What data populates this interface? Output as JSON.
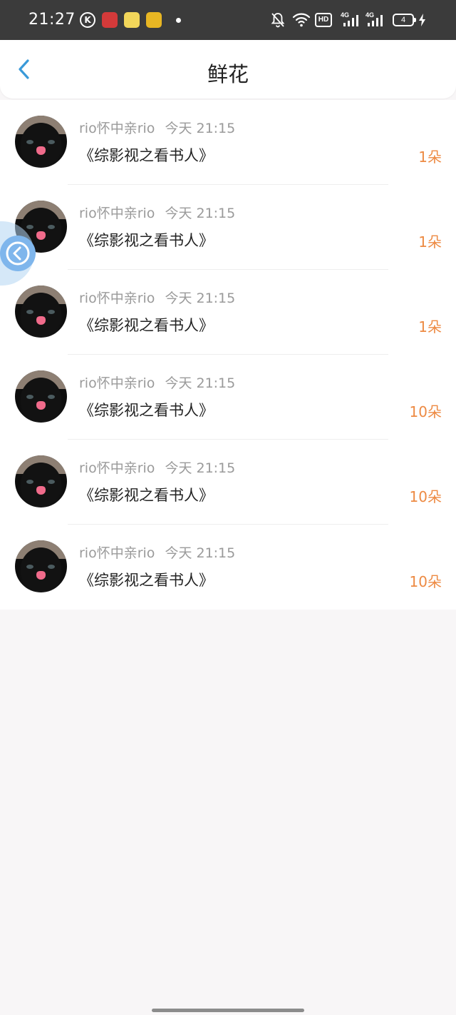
{
  "status_bar": {
    "time": "21:27",
    "k_label": "K",
    "hd_label": "HD",
    "network_1": "4G",
    "network_2": "4G",
    "battery": "4"
  },
  "header": {
    "title": "鲜花",
    "back_icon": "chevron-left-icon"
  },
  "accent_colors": {
    "back": "#3a9ad9",
    "count": "#ed8a43"
  },
  "items": [
    {
      "user": "rio怀中亲rio",
      "time": "今天 21:15",
      "book": "《综影视之看书人》",
      "count": "1朵"
    },
    {
      "user": "rio怀中亲rio",
      "time": "今天 21:15",
      "book": "《综影视之看书人》",
      "count": "1朵"
    },
    {
      "user": "rio怀中亲rio",
      "time": "今天 21:15",
      "book": "《综影视之看书人》",
      "count": "1朵"
    },
    {
      "user": "rio怀中亲rio",
      "time": "今天 21:15",
      "book": "《综影视之看书人》",
      "count": "10朵"
    },
    {
      "user": "rio怀中亲rio",
      "time": "今天 21:15",
      "book": "《综影视之看书人》",
      "count": "10朵"
    },
    {
      "user": "rio怀中亲rio",
      "time": "今天 21:15",
      "book": "《综影视之看书人》",
      "count": "10朵"
    }
  ]
}
